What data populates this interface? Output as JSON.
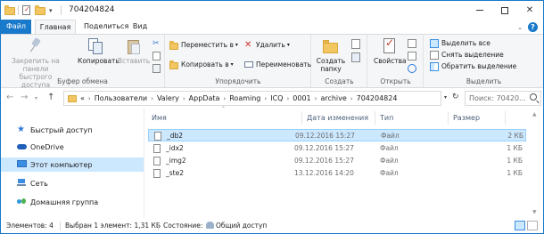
{
  "window": {
    "title": "704204824",
    "qat_arrow": "▾"
  },
  "tabs": {
    "file": "Файл",
    "home": "Главная",
    "share": "Поделиться",
    "view": "Вид",
    "help": "?"
  },
  "ribbon": {
    "clipboard": {
      "label": "Буфер обмена",
      "pin_label_line1": "Закрепить на панели",
      "pin_label_line2": "быстрого доступа",
      "copy_label": "Копировать",
      "paste_label": "Вставить"
    },
    "organize": {
      "label": "Упорядочить",
      "move_to": "Переместить в",
      "copy_to": "Копировать в",
      "delete": "Удалить",
      "rename": "Переименовать"
    },
    "new": {
      "label": "Создать",
      "new_folder_line1": "Создать",
      "new_folder_line2": "папку"
    },
    "open": {
      "label": "Открыть",
      "properties": "Свойства"
    },
    "select": {
      "label": "Выделить",
      "select_all": "Выделить все",
      "select_none": "Снять выделение",
      "invert": "Обратить выделение"
    }
  },
  "address": {
    "prefix": "«",
    "crumbs": [
      "Пользователи",
      "Valery",
      "AppData",
      "Roaming",
      "ICQ",
      "0001",
      "archive",
      "704204824"
    ],
    "search_placeholder": "Поиск: 70420..."
  },
  "navigation": {
    "items": [
      {
        "label": "Быстрый доступ",
        "icon": "star-icon"
      },
      {
        "label": "OneDrive",
        "icon": "cloud-icon"
      },
      {
        "label": "Этот компьютер",
        "icon": "computer-icon",
        "selected": true
      },
      {
        "label": "Сеть",
        "icon": "network-icon"
      },
      {
        "label": "Домашняя группа",
        "icon": "homegroup-icon"
      }
    ]
  },
  "columns": {
    "name": "Имя",
    "date": "Дата изменения",
    "type": "Тип",
    "size": "Размер"
  },
  "files": [
    {
      "name": "_db2",
      "date": "09.12.2016 15:27",
      "type": "Файл",
      "size": "2 КБ",
      "selected": true
    },
    {
      "name": "_idx2",
      "date": "09.12.2016 15:27",
      "type": "Файл",
      "size": "1 КБ"
    },
    {
      "name": "_img2",
      "date": "09.12.2016 15:27",
      "type": "Файл",
      "size": "1 КБ"
    },
    {
      "name": "_ste2",
      "date": "13.12.2016 14:20",
      "type": "Файл",
      "size": "1 КБ"
    }
  ],
  "status": {
    "count": "Элементов: 4",
    "selection": "Выбран 1 элемент: 1,31 КБ",
    "state": "Состояние:",
    "shared": "Общий доступ"
  },
  "colors": {
    "accent": "#1979ca",
    "selection": "#cce8ff"
  }
}
